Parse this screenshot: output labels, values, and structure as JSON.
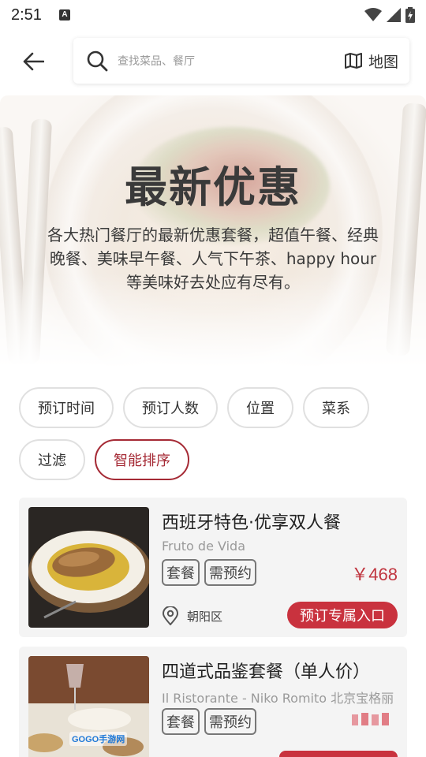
{
  "status_bar": {
    "time": "2:51",
    "notification_icon": "A"
  },
  "header": {
    "search_placeholder": "查找菜品、餐厅",
    "map_label": "地图"
  },
  "banner": {
    "title": "最新优惠",
    "description": "各大热门餐厅的最新优惠套餐，超值午餐、经典晚餐、美味早午餐、人气下午茶、happy hour等美味好去处应有尽有。"
  },
  "filters": [
    {
      "label": "预订时间",
      "active": false
    },
    {
      "label": "预订人数",
      "active": false
    },
    {
      "label": "位置",
      "active": false
    },
    {
      "label": "菜系",
      "active": false
    },
    {
      "label": "过滤",
      "active": false
    },
    {
      "label": "智能排序",
      "active": true
    }
  ],
  "cards": [
    {
      "title": "西班牙特色·优享双人餐",
      "restaurant": "Fruto de Vida",
      "tags": [
        "套餐",
        "需预约"
      ],
      "price": "￥468",
      "district": "朝阳区",
      "book_label": "预订专属入口"
    },
    {
      "title": "四道式品鉴套餐（单人价）",
      "restaurant": "Il Ristorante - Niko Romito 北京宝格丽",
      "tags": [
        "套餐",
        "需预约"
      ],
      "price": "",
      "district": "",
      "book_label": ""
    }
  ],
  "colors": {
    "accent": "#c9323e",
    "active_chip": "#a52a35"
  },
  "watermark": "GOGO手游网"
}
